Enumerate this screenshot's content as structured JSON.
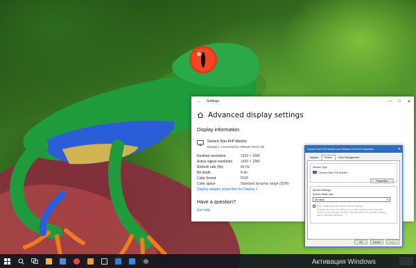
{
  "settings": {
    "window_title": "Settings",
    "page_title": "Advanced display settings",
    "display_info_heading": "Display information",
    "monitor_name": "Generic Non-PnP Monitor",
    "monitor_desc": "Display 1: Connected to VMware SVGA 3D",
    "rows": [
      {
        "label": "Desktop resolution",
        "value": "1920 × 1080"
      },
      {
        "label": "Active signal resolution",
        "value": "1920 × 1080"
      },
      {
        "label": "Refresh rate (Hz)",
        "value": "60 Hz"
      },
      {
        "label": "Bit depth",
        "value": "8-bit"
      },
      {
        "label": "Color format",
        "value": "RGB"
      },
      {
        "label": "Color space",
        "value": "Standard dynamic range (SDR)"
      }
    ],
    "adapter_link": "Display adapter properties for Display 1",
    "question": "Have a question?",
    "help_link": "Get help"
  },
  "dialog": {
    "title": "Generic Non-PnP Monitor and VMware SVGA 3D Properties",
    "tabs": [
      "Adapter",
      "Monitor",
      "Color Management"
    ],
    "active_tab": 1,
    "monitor_type_label": "Monitor Type",
    "monitor_name": "Generic Non-PnP Monitor",
    "properties_button": "Properties",
    "monitor_settings_label": "Monitor Settings",
    "refresh_label": "Screen refresh rate:",
    "refresh_value": "60 Hertz",
    "hide_modes_label": "Hide modes that this monitor cannot display",
    "hide_modes_note": "Clearing this check box allows you to select display modes that this monitor cannot display correctly. This may lead to an unusable display and/or damaged hardware.",
    "ok": "OK",
    "cancel": "Cancel",
    "apply": "Apply"
  },
  "taskbar": {
    "watermark": "Активация Windows",
    "icons": [
      {
        "name": "start-icon",
        "color": "#ffffff"
      },
      {
        "name": "search-icon",
        "color": "#ffffff"
      },
      {
        "name": "task-view-icon",
        "color": "#ffffff"
      },
      {
        "name": "file-explorer-icon",
        "color": "#e8b84a"
      },
      {
        "name": "store-icon",
        "color": "#4a90d9"
      },
      {
        "name": "chrome-icon",
        "color": "#e94b35"
      },
      {
        "name": "photos-icon",
        "color": "#e9a23b"
      },
      {
        "name": "terminal-icon",
        "color": "#dddddd"
      },
      {
        "name": "mail-icon",
        "color": "#3a7bd5"
      },
      {
        "name": "mixer-icon",
        "color": "#2d89ef"
      },
      {
        "name": "settings-icon",
        "color": "#ffffff"
      }
    ]
  }
}
